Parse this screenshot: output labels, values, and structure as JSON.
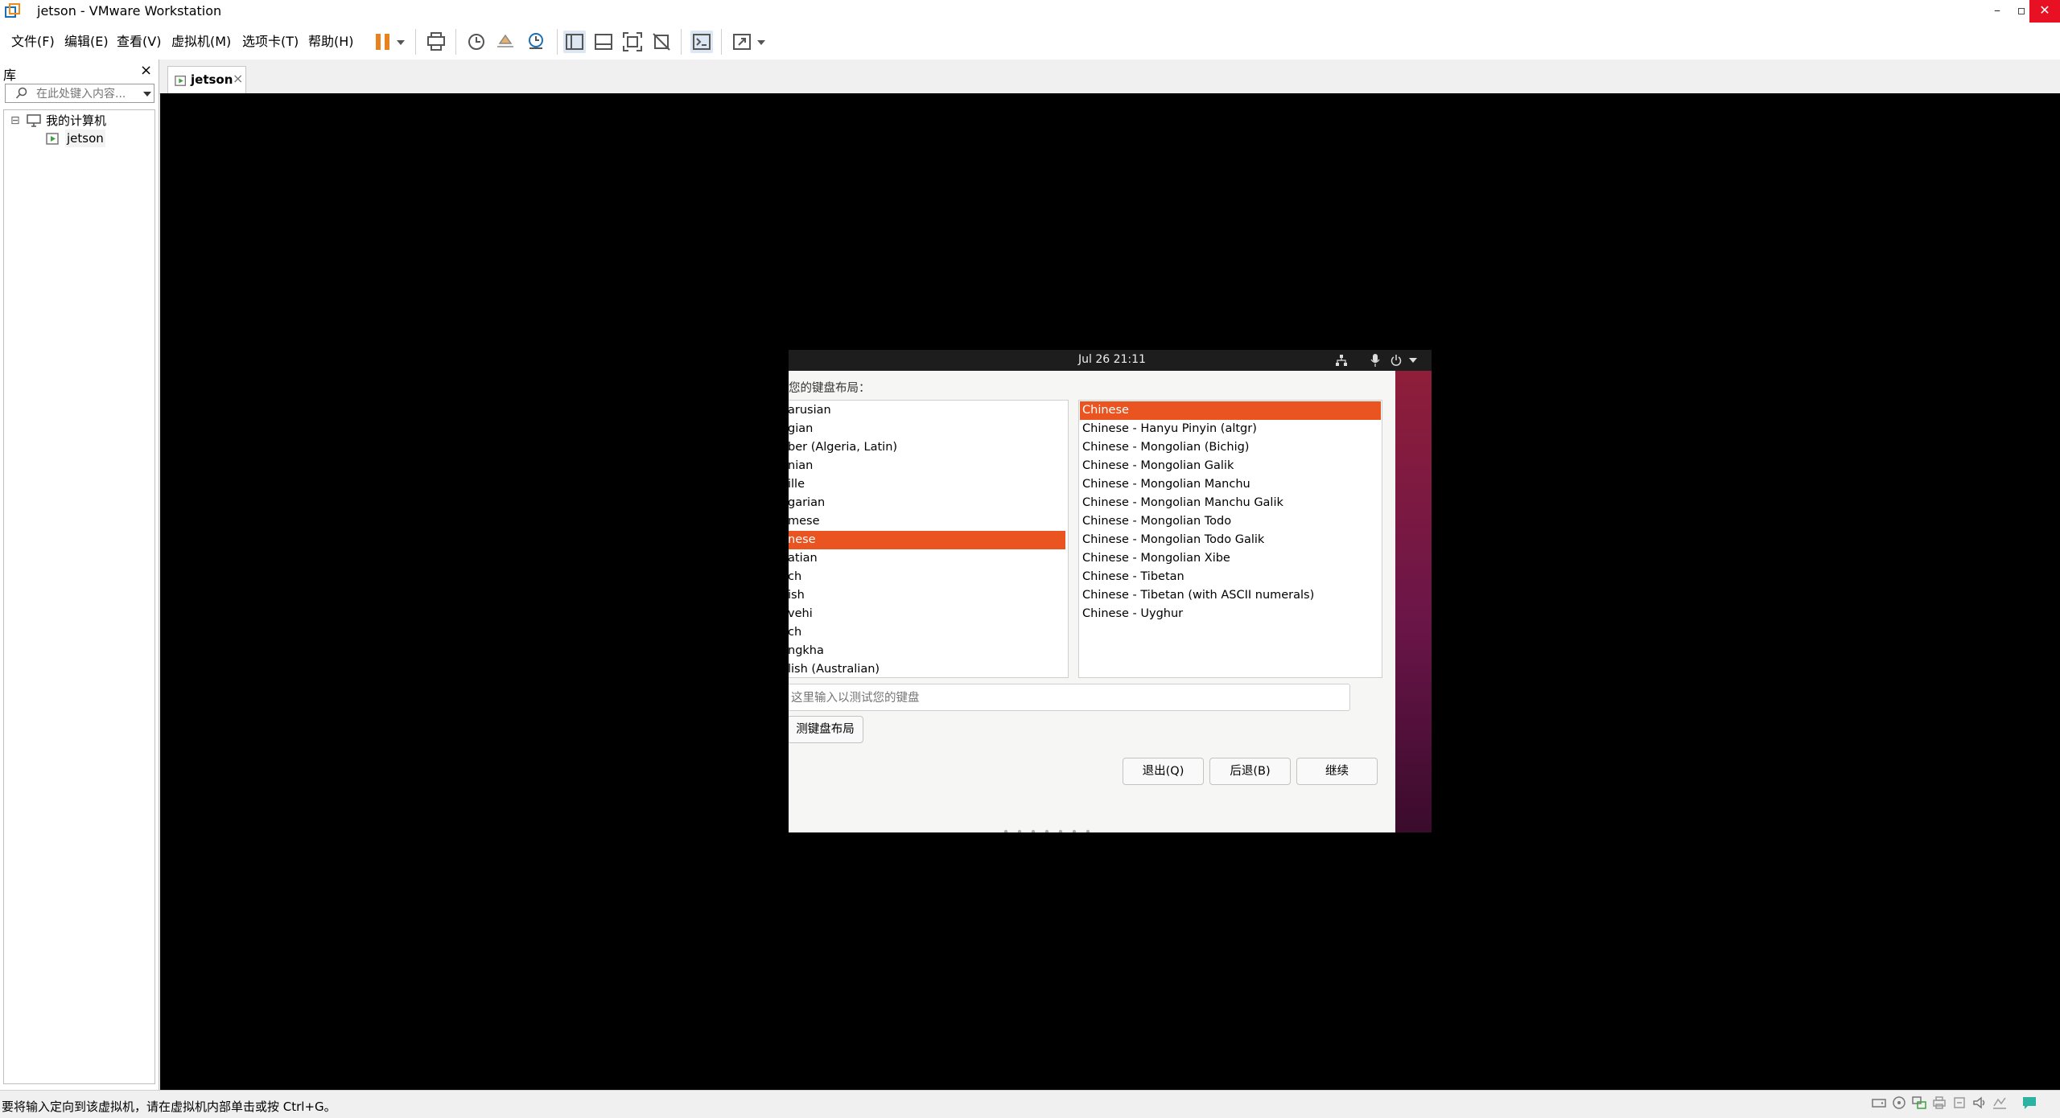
{
  "window": {
    "title": "jetson - VMware Workstation",
    "controls": {
      "minimize": "–",
      "restore": "▫",
      "close": "✕"
    }
  },
  "menu": [
    "文件(F)",
    "编辑(E)",
    "查看(V)",
    "虚拟机(M)",
    "选项卡(T)",
    "帮助(H)"
  ],
  "library": {
    "title": "库",
    "close": "×",
    "search_placeholder": "在此处键入内容...",
    "tree": {
      "expander": "⊟",
      "root": "我的计算机",
      "child": "jetson"
    }
  },
  "tab": {
    "label": "jetson",
    "close": "×"
  },
  "ubuntu": {
    "clock": "Jul 26  21:11",
    "prompt": "您的键盘布局：",
    "layouts": [
      "arusian",
      "gian",
      "ber (Algeria, Latin)",
      "nian",
      "ille",
      "garian",
      "mese",
      "nese",
      "atian",
      "ch",
      "ish",
      "vehi",
      "ch",
      "ngkha",
      "lish (Australian)"
    ],
    "layouts_selected": 7,
    "variants": [
      "Chinese",
      "Chinese - Hanyu Pinyin (altgr)",
      "Chinese - Mongolian (Bichig)",
      "Chinese - Mongolian Galik",
      "Chinese - Mongolian Manchu",
      "Chinese - Mongolian Manchu Galik",
      "Chinese - Mongolian Todo",
      "Chinese - Mongolian Todo Galik",
      "Chinese - Mongolian Xibe",
      "Chinese - Tibetan",
      "Chinese - Tibetan (with ASCII numerals)",
      "Chinese - Uyghur"
    ],
    "variants_selected": 0,
    "test_placeholder": "这里输入以测试您的键盘",
    "detect_button": "测键盘布局",
    "quit_button": "退出(Q)",
    "back_button": "后退(B)",
    "continue_button": "继续"
  },
  "status": {
    "text": "要将输入定向到该虚拟机，请在虚拟机内部单击或按 Ctrl+G。"
  },
  "colors": {
    "accent": "#e95420",
    "close": "#e81123",
    "pause": "#e8821e",
    "vm_bg": "#000000"
  }
}
